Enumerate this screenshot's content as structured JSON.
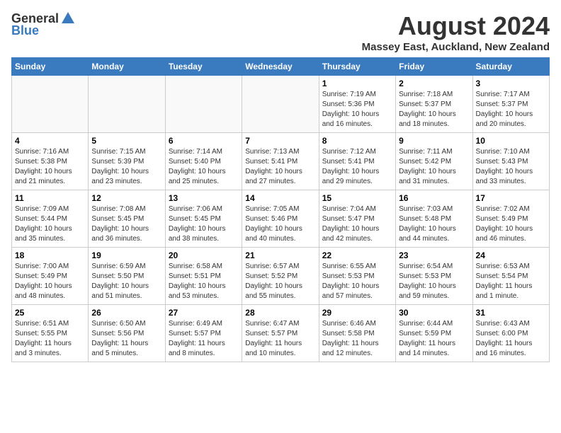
{
  "header": {
    "logo_general": "General",
    "logo_blue": "Blue",
    "month_title": "August 2024",
    "location": "Massey East, Auckland, New Zealand"
  },
  "weekdays": [
    "Sunday",
    "Monday",
    "Tuesday",
    "Wednesday",
    "Thursday",
    "Friday",
    "Saturday"
  ],
  "weeks": [
    [
      {
        "day": "",
        "info": ""
      },
      {
        "day": "",
        "info": ""
      },
      {
        "day": "",
        "info": ""
      },
      {
        "day": "",
        "info": ""
      },
      {
        "day": "1",
        "info": "Sunrise: 7:19 AM\nSunset: 5:36 PM\nDaylight: 10 hours\nand 16 minutes."
      },
      {
        "day": "2",
        "info": "Sunrise: 7:18 AM\nSunset: 5:37 PM\nDaylight: 10 hours\nand 18 minutes."
      },
      {
        "day": "3",
        "info": "Sunrise: 7:17 AM\nSunset: 5:37 PM\nDaylight: 10 hours\nand 20 minutes."
      }
    ],
    [
      {
        "day": "4",
        "info": "Sunrise: 7:16 AM\nSunset: 5:38 PM\nDaylight: 10 hours\nand 21 minutes."
      },
      {
        "day": "5",
        "info": "Sunrise: 7:15 AM\nSunset: 5:39 PM\nDaylight: 10 hours\nand 23 minutes."
      },
      {
        "day": "6",
        "info": "Sunrise: 7:14 AM\nSunset: 5:40 PM\nDaylight: 10 hours\nand 25 minutes."
      },
      {
        "day": "7",
        "info": "Sunrise: 7:13 AM\nSunset: 5:41 PM\nDaylight: 10 hours\nand 27 minutes."
      },
      {
        "day": "8",
        "info": "Sunrise: 7:12 AM\nSunset: 5:41 PM\nDaylight: 10 hours\nand 29 minutes."
      },
      {
        "day": "9",
        "info": "Sunrise: 7:11 AM\nSunset: 5:42 PM\nDaylight: 10 hours\nand 31 minutes."
      },
      {
        "day": "10",
        "info": "Sunrise: 7:10 AM\nSunset: 5:43 PM\nDaylight: 10 hours\nand 33 minutes."
      }
    ],
    [
      {
        "day": "11",
        "info": "Sunrise: 7:09 AM\nSunset: 5:44 PM\nDaylight: 10 hours\nand 35 minutes."
      },
      {
        "day": "12",
        "info": "Sunrise: 7:08 AM\nSunset: 5:45 PM\nDaylight: 10 hours\nand 36 minutes."
      },
      {
        "day": "13",
        "info": "Sunrise: 7:06 AM\nSunset: 5:45 PM\nDaylight: 10 hours\nand 38 minutes."
      },
      {
        "day": "14",
        "info": "Sunrise: 7:05 AM\nSunset: 5:46 PM\nDaylight: 10 hours\nand 40 minutes."
      },
      {
        "day": "15",
        "info": "Sunrise: 7:04 AM\nSunset: 5:47 PM\nDaylight: 10 hours\nand 42 minutes."
      },
      {
        "day": "16",
        "info": "Sunrise: 7:03 AM\nSunset: 5:48 PM\nDaylight: 10 hours\nand 44 minutes."
      },
      {
        "day": "17",
        "info": "Sunrise: 7:02 AM\nSunset: 5:49 PM\nDaylight: 10 hours\nand 46 minutes."
      }
    ],
    [
      {
        "day": "18",
        "info": "Sunrise: 7:00 AM\nSunset: 5:49 PM\nDaylight: 10 hours\nand 48 minutes."
      },
      {
        "day": "19",
        "info": "Sunrise: 6:59 AM\nSunset: 5:50 PM\nDaylight: 10 hours\nand 51 minutes."
      },
      {
        "day": "20",
        "info": "Sunrise: 6:58 AM\nSunset: 5:51 PM\nDaylight: 10 hours\nand 53 minutes."
      },
      {
        "day": "21",
        "info": "Sunrise: 6:57 AM\nSunset: 5:52 PM\nDaylight: 10 hours\nand 55 minutes."
      },
      {
        "day": "22",
        "info": "Sunrise: 6:55 AM\nSunset: 5:53 PM\nDaylight: 10 hours\nand 57 minutes."
      },
      {
        "day": "23",
        "info": "Sunrise: 6:54 AM\nSunset: 5:53 PM\nDaylight: 10 hours\nand 59 minutes."
      },
      {
        "day": "24",
        "info": "Sunrise: 6:53 AM\nSunset: 5:54 PM\nDaylight: 11 hours\nand 1 minute."
      }
    ],
    [
      {
        "day": "25",
        "info": "Sunrise: 6:51 AM\nSunset: 5:55 PM\nDaylight: 11 hours\nand 3 minutes."
      },
      {
        "day": "26",
        "info": "Sunrise: 6:50 AM\nSunset: 5:56 PM\nDaylight: 11 hours\nand 5 minutes."
      },
      {
        "day": "27",
        "info": "Sunrise: 6:49 AM\nSunset: 5:57 PM\nDaylight: 11 hours\nand 8 minutes."
      },
      {
        "day": "28",
        "info": "Sunrise: 6:47 AM\nSunset: 5:57 PM\nDaylight: 11 hours\nand 10 minutes."
      },
      {
        "day": "29",
        "info": "Sunrise: 6:46 AM\nSunset: 5:58 PM\nDaylight: 11 hours\nand 12 minutes."
      },
      {
        "day": "30",
        "info": "Sunrise: 6:44 AM\nSunset: 5:59 PM\nDaylight: 11 hours\nand 14 minutes."
      },
      {
        "day": "31",
        "info": "Sunrise: 6:43 AM\nSunset: 6:00 PM\nDaylight: 11 hours\nand 16 minutes."
      }
    ]
  ]
}
